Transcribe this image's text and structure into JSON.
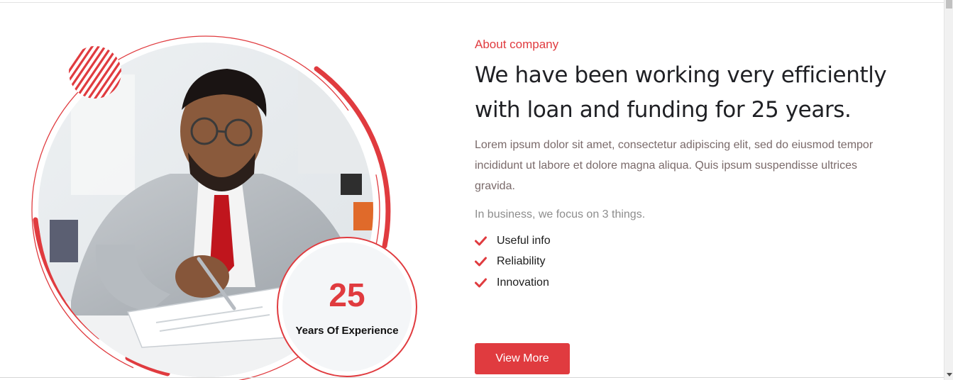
{
  "about": {
    "eyebrow": "About company",
    "headline": "We have been working very efficiently with loan and funding for 25 years.",
    "body": "Lorem ipsum dolor sit amet, consectetur adipiscing elit, sed do eiusmod tempor incididunt ut labore et dolore magna aliqua. Quis ipsum suspendisse ultrices gravida.",
    "focus": "In business, we focus on 3 things.",
    "checklist": [
      {
        "label": "Useful info",
        "icon": "check-icon"
      },
      {
        "label": "Reliability",
        "icon": "check-icon"
      },
      {
        "label": "Innovation",
        "icon": "check-icon"
      }
    ],
    "button_label": "View More"
  },
  "experience": {
    "number": "25",
    "label": "Years Of Experience"
  },
  "colors": {
    "accent": "#e03b3f",
    "heading": "#1f2024",
    "body": "#7a6a6a",
    "muted": "#8d8d8d"
  }
}
